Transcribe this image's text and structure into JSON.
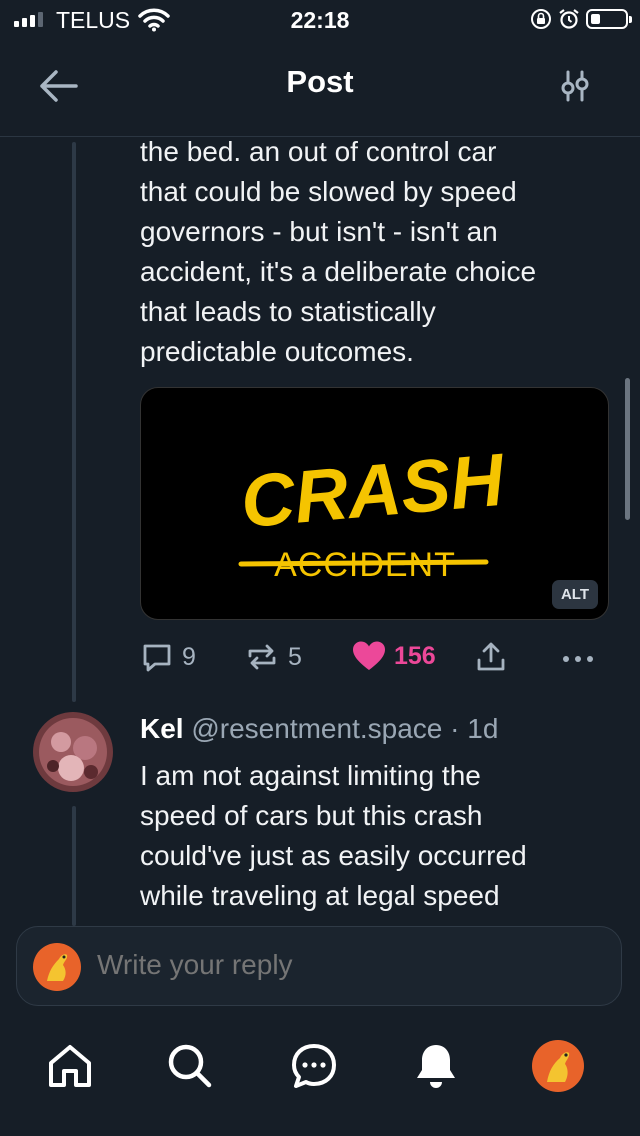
{
  "status_bar": {
    "carrier": "TELUS",
    "time": "22:18"
  },
  "header": {
    "title": "Post"
  },
  "post": {
    "text_lines": [
      "the bed. an out of control car",
      "that could be slowed by speed",
      "governors - but isn't - isn't an",
      "accident, it's a deliberate choice",
      "that leads to statistically",
      "predictable outcomes."
    ],
    "media": {
      "word_main": "CRASH",
      "word_struck": "ACCIDENT",
      "alt_label": "ALT",
      "accent_color": "#f5c400"
    },
    "actions": {
      "replies": "9",
      "reposts": "5",
      "likes": "156"
    }
  },
  "reply": {
    "display_name": "Kel",
    "handle": "@resentment.space",
    "age": "· 1d",
    "text_lines": [
      "I am not against limiting the",
      "speed of cars but this crash",
      "could've just as easily occurred",
      "while traveling at legal speed"
    ]
  },
  "composer": {
    "placeholder": "Write your reply"
  },
  "colors": {
    "background": "#161e27",
    "like": "#ec4899",
    "muted": "#a6b3c0"
  }
}
